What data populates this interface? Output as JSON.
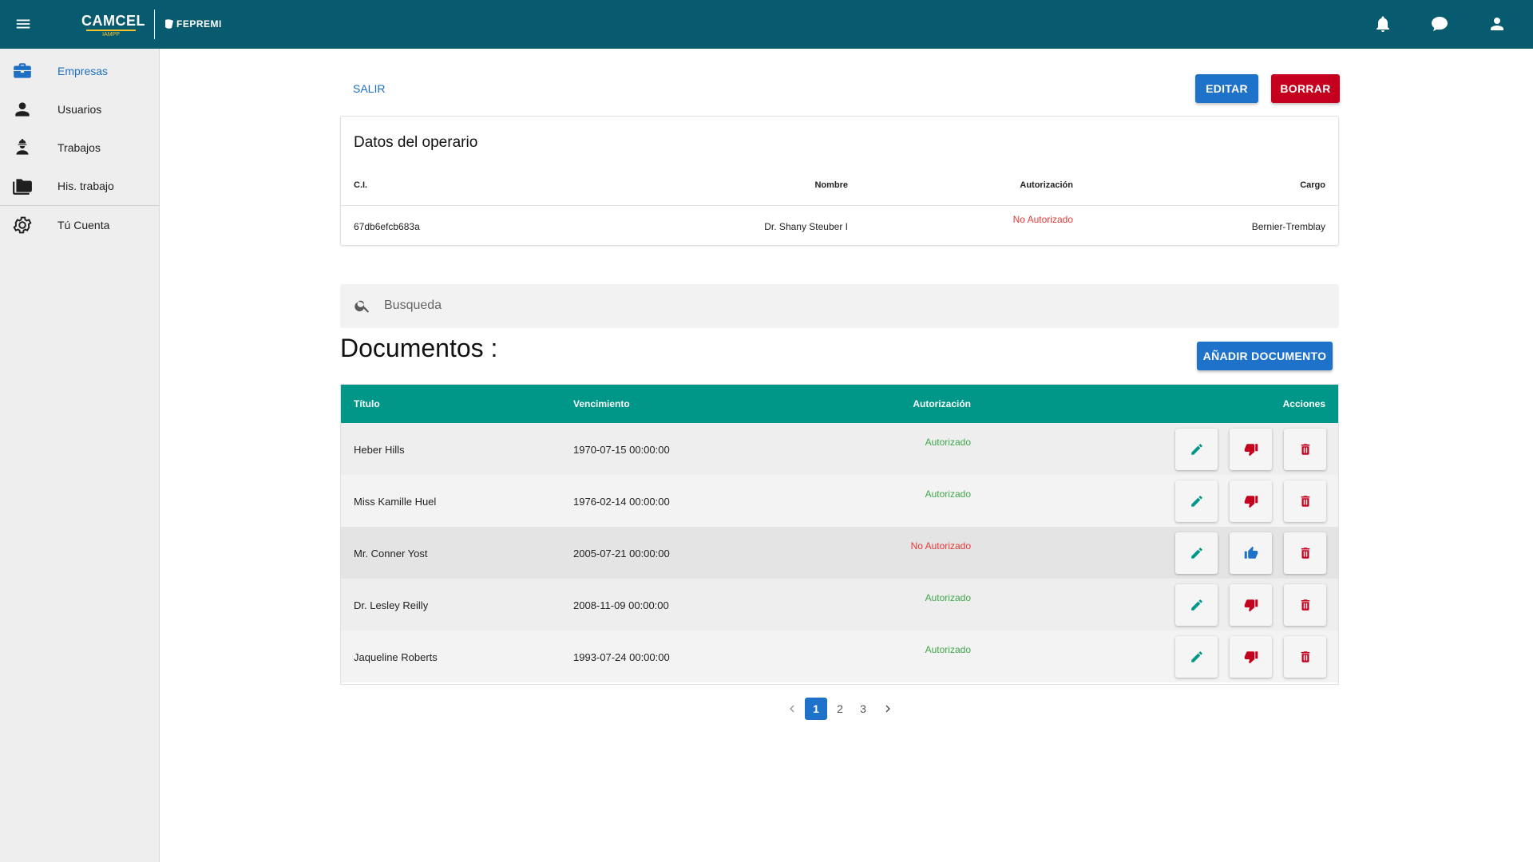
{
  "header": {
    "logo_main": "CAMCEL",
    "logo_sub": "IAMPP",
    "logo_secondary": "FEPREMI",
    "icons": [
      "menu-icon",
      "bell-icon",
      "chat-icon",
      "account-icon"
    ]
  },
  "sidebar": {
    "items": [
      {
        "label": "Empresas",
        "icon": "briefcase-icon",
        "active": true
      },
      {
        "label": "Usuarios",
        "icon": "person-icon"
      },
      {
        "label": "Trabajos",
        "icon": "worker-icon"
      },
      {
        "label": "His. trabajo",
        "icon": "folder-icon"
      },
      {
        "label": "Tú Cuenta",
        "icon": "gear-icon"
      }
    ]
  },
  "actions": {
    "exit_label": "SALIR",
    "edit_label": "EDITAR",
    "delete_label": "BORRAR"
  },
  "operator": {
    "title": "Datos del operario",
    "headers": {
      "ci": "C.I.",
      "name": "Nombre",
      "auth": "Autorización",
      "role": "Cargo"
    },
    "values": {
      "ci": "67db6efcb683a",
      "name": "Dr. Shany Steuber I",
      "auth": "No Autorizado",
      "role": "Bernier-Tremblay"
    }
  },
  "search": {
    "placeholder": "Busqueda"
  },
  "documents": {
    "title": "Documentos :",
    "add_label": "AÑADIR DOCUMENTO",
    "headers": {
      "title": "Título",
      "due": "Vencimiento",
      "auth": "Autorización",
      "actions": "Acciones"
    },
    "rows": [
      {
        "title": "Heber Hills",
        "due": "1970-07-15 00:00:00",
        "auth": "Autorizado"
      },
      {
        "title": "Miss Kamille Huel",
        "due": "1976-02-14 00:00:00",
        "auth": "Autorizado"
      },
      {
        "title": "Mr. Conner Yost",
        "due": "2005-07-21 00:00:00",
        "auth": "No Autorizado"
      },
      {
        "title": "Dr. Lesley Reilly",
        "due": "2008-11-09 00:00:00",
        "auth": "Autorizado"
      },
      {
        "title": "Jaqueline Roberts",
        "due": "1993-07-24 00:00:00",
        "auth": "Autorizado"
      }
    ]
  },
  "pagination": {
    "pages": [
      "1",
      "2",
      "3"
    ],
    "current": "1"
  },
  "colors": {
    "topbar": "#085a6e",
    "accent_blue": "#1e72c9",
    "danger_red": "#c4001e",
    "table_header": "#009688",
    "authorized_green": "#3fa84a",
    "unauthorized_red": "#e53935"
  }
}
